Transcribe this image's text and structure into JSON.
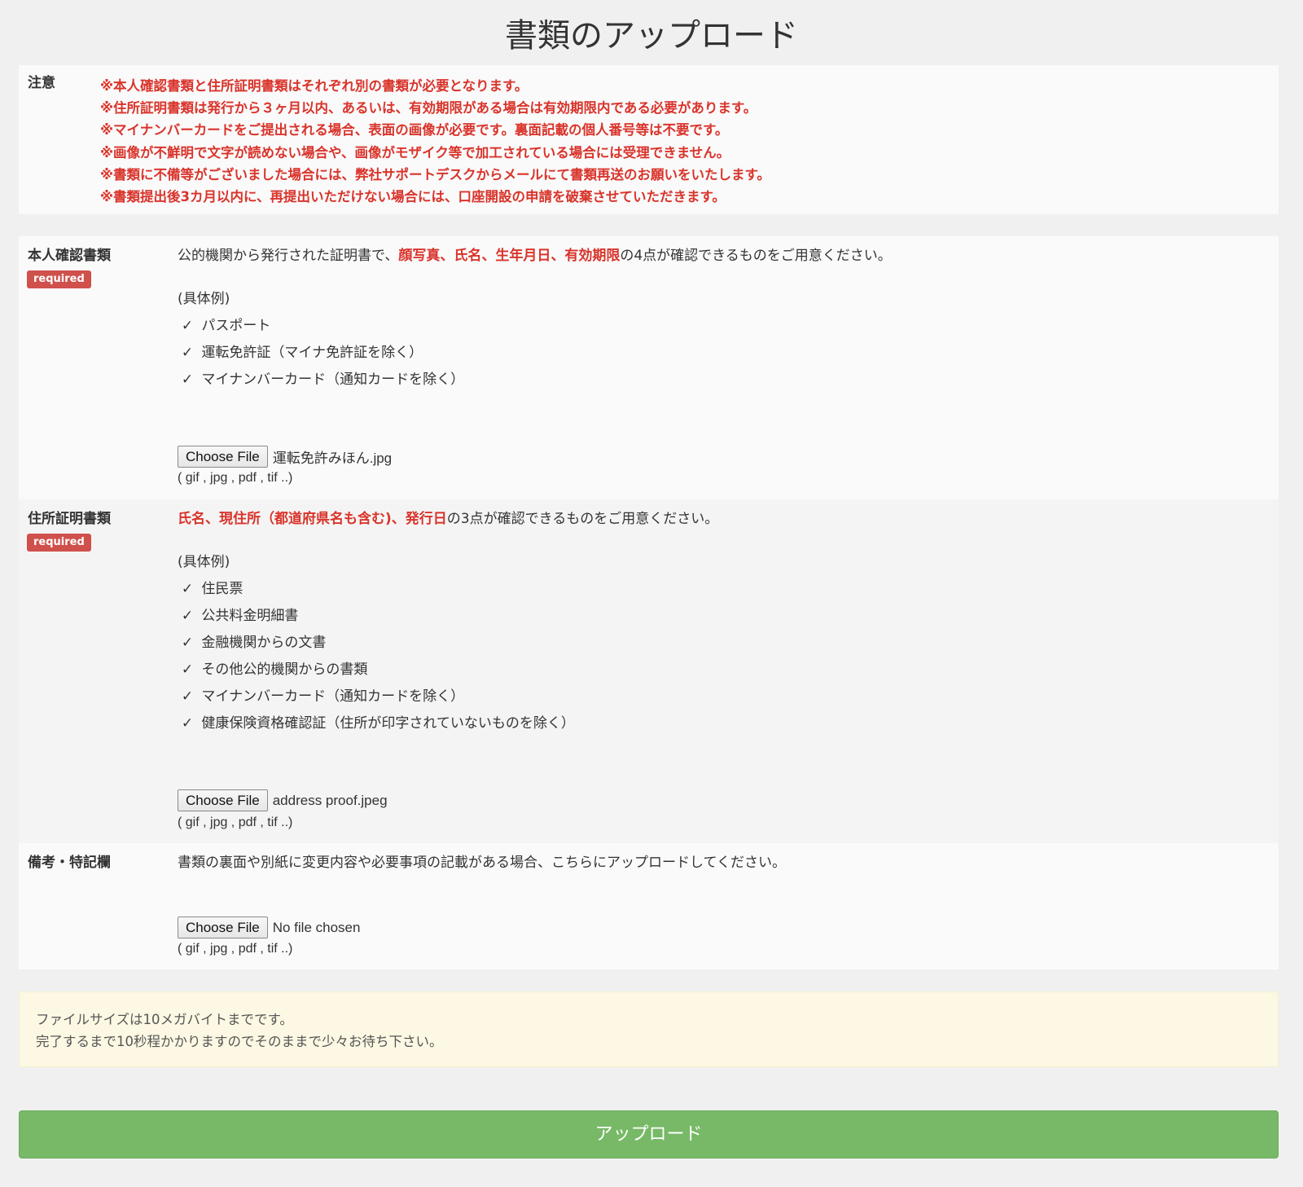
{
  "page": {
    "title": "書類のアップロード"
  },
  "notice": {
    "label": "注意",
    "lines": [
      "※本人確認書類と住所証明書類はそれぞれ別の書類が必要となります。",
      "※住所証明書類は発行から３ヶ月以内、あるいは、有効期限がある場合は有効期限内である必要があります。",
      "※マイナンバーカードをご提出される場合、表面の画像が必要です。裏面記載の個人番号等は不要です。",
      "※画像が不鮮明で文字が読めない場合や、画像がモザイク等で加工されている場合には受理できません。",
      "※書類に不備等がございました場合には、弊社サポートデスクからメールにて書類再送のお願いをいたします。",
      "※書類提出後3カ月以内に、再提出いただけない場合には、口座開設の申請を破棄させていただきます。"
    ]
  },
  "identity": {
    "label": "本人確認書類",
    "badge": "required",
    "desc_prefix": "公的機関から発行された証明書で、",
    "desc_highlight": "顔写真、氏名、生年月日、有効期限",
    "desc_suffix": "の4点が確認できるものをご用意ください。",
    "examples_title": "(具体例)",
    "examples": [
      "パスポート",
      "運転免許証（マイナ免許証を除く）",
      "マイナンバーカード（通知カードを除く）"
    ],
    "file_button": "Choose File",
    "file_name": "運転免許みほん.jpg",
    "file_hint": "( gif , jpg , pdf , tif ..)"
  },
  "address": {
    "label": "住所証明書類",
    "badge": "required",
    "desc_highlight": "氏名、現住所（都道府県名も含む)、発行日",
    "desc_suffix": "の3点が確認できるものをご用意ください。",
    "examples_title": "(具体例)",
    "examples": [
      "住民票",
      "公共料金明細書",
      "金融機関からの文書",
      "その他公的機関からの書類",
      "マイナンバーカード（通知カードを除く）",
      "健康保険資格確認証（住所が印字されていないものを除く）"
    ],
    "file_button": "Choose File",
    "file_name": "address proof.jpeg",
    "file_hint": "( gif , jpg , pdf , tif ..)"
  },
  "remarks": {
    "label": "備考・特記欄",
    "desc": "書類の裏面や別紙に変更内容や必要事項の記載がある場合、こちらにアップロードしてください。",
    "file_button": "Choose File",
    "file_name": "No file chosen",
    "file_hint": "( gif , jpg , pdf , tif ..)"
  },
  "info": {
    "line1": "ファイルサイズは10メガバイトまでです。",
    "line2": "完了するまで10秒程かかりますのでそのままで少々お待ち下さい。"
  },
  "submit": {
    "label": "アップロード"
  },
  "check_glyph": "✓",
  "colors": {
    "emphasis_red": "#d9342b",
    "badge_red": "#d0504b",
    "upload_green": "#77b967",
    "info_background": "#fcf8e3"
  }
}
